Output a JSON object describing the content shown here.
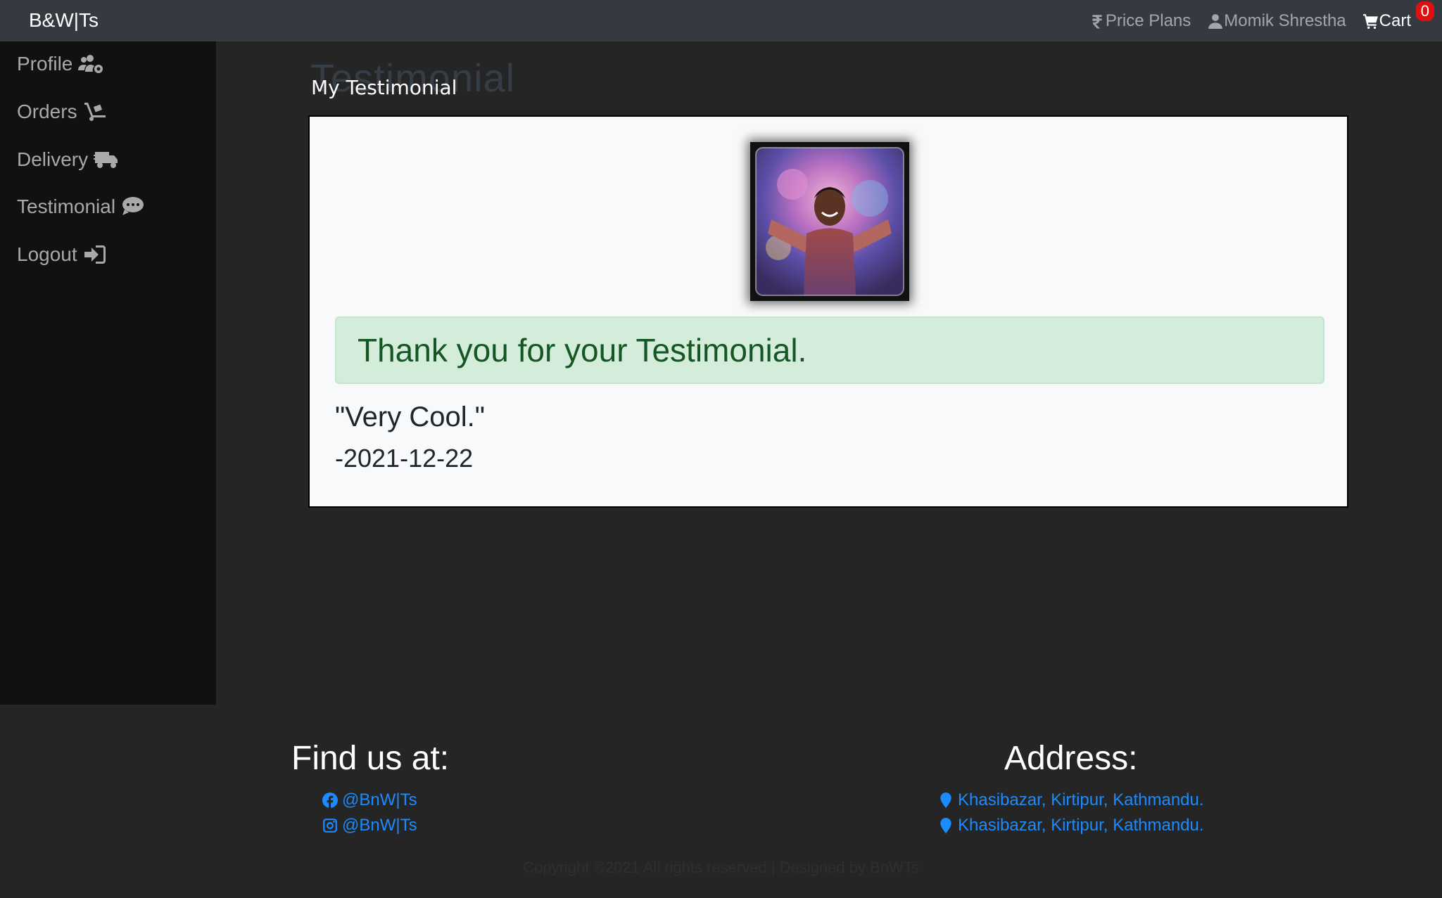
{
  "navbar": {
    "brand": "B&W|Ts",
    "price_plans": "Price Plans",
    "user_name": "Momik Shrestha",
    "cart_label": "Cart",
    "cart_count": "0"
  },
  "sidebar": {
    "items": [
      {
        "label": "Profile",
        "icon": "users-cog-icon"
      },
      {
        "label": "Orders",
        "icon": "dolly-icon"
      },
      {
        "label": "Delivery",
        "icon": "truck-icon"
      },
      {
        "label": "Testimonial",
        "icon": "comment-icon"
      },
      {
        "label": "Logout",
        "icon": "sign-in-icon"
      }
    ]
  },
  "main": {
    "ghost_title": "Testimonial",
    "title": "My Testimonial",
    "alert": "Thank you for your Testimonial.",
    "quote": "\"Very Cool.\"",
    "date": "-2021-12-22"
  },
  "footer": {
    "find_heading": "Find us at:",
    "facebook": "@BnW|Ts",
    "instagram": "@BnW|Ts",
    "address_heading": "Address:",
    "address1": "Khasibazar, Kirtipur, Kathmandu.",
    "address2": "Khasibazar, Kirtipur, Kathmandu.",
    "copyright": "Copyright ©2021 All rights reserved | Designed by BnWTs"
  },
  "colors": {
    "navbar": "#343a40",
    "sidebar": "#111111",
    "page_bg": "#252525",
    "alert_bg": "#d4edda",
    "alert_text": "#155724",
    "link": "#1a8cff",
    "badge": "#e01010"
  }
}
